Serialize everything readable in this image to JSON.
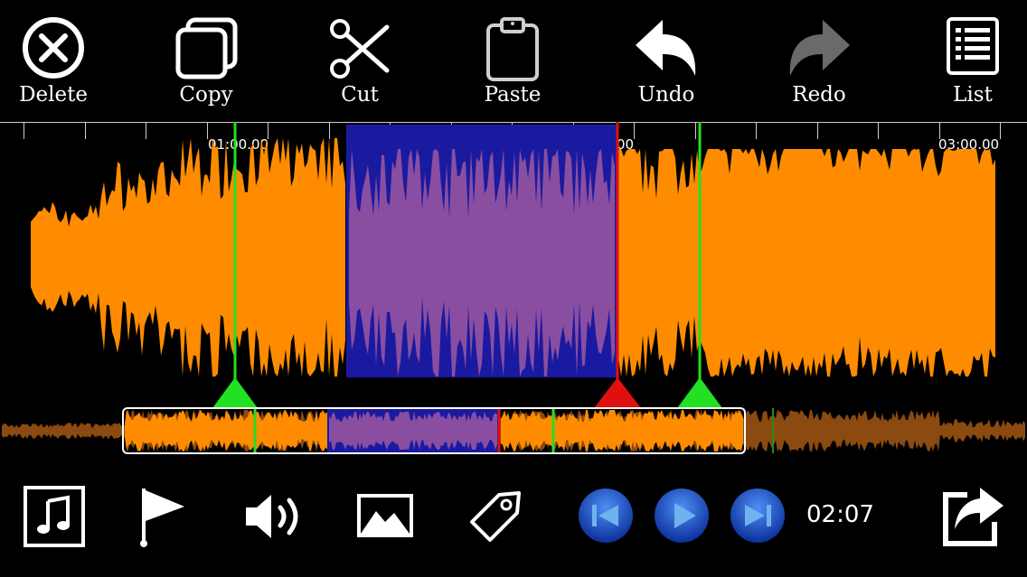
{
  "toolbar": {
    "delete_label": "Delete",
    "copy_label": "Copy",
    "cut_label": "Cut",
    "paste_label": "Paste",
    "undo_label": "Undo",
    "redo_label": "Redo",
    "list_label": "List"
  },
  "timeline": {
    "labels": [
      "01:00.00",
      "02:00.00",
      "03:00.00"
    ]
  },
  "playback": {
    "current_time": "02:07"
  },
  "colors": {
    "waveform": "#ff8c00",
    "selection": "#1a1aa0",
    "selection_wave": "#8a4ea0",
    "marker_green": "#22e022",
    "marker_red": "#e01010",
    "transport_blue": "#1e5fd6"
  },
  "icons": {
    "delete": "close-circle-icon",
    "copy": "copy-icon",
    "cut": "scissors-icon",
    "paste": "clipboard-icon",
    "undo": "undo-arrow-icon",
    "redo": "redo-arrow-icon",
    "list": "list-icon",
    "music": "music-note-icon",
    "flag": "flag-icon",
    "volume": "speaker-icon",
    "image": "picture-icon",
    "tag": "tag-icon",
    "prev": "skip-back-icon",
    "play": "play-icon",
    "next": "skip-forward-icon",
    "share": "share-icon"
  }
}
